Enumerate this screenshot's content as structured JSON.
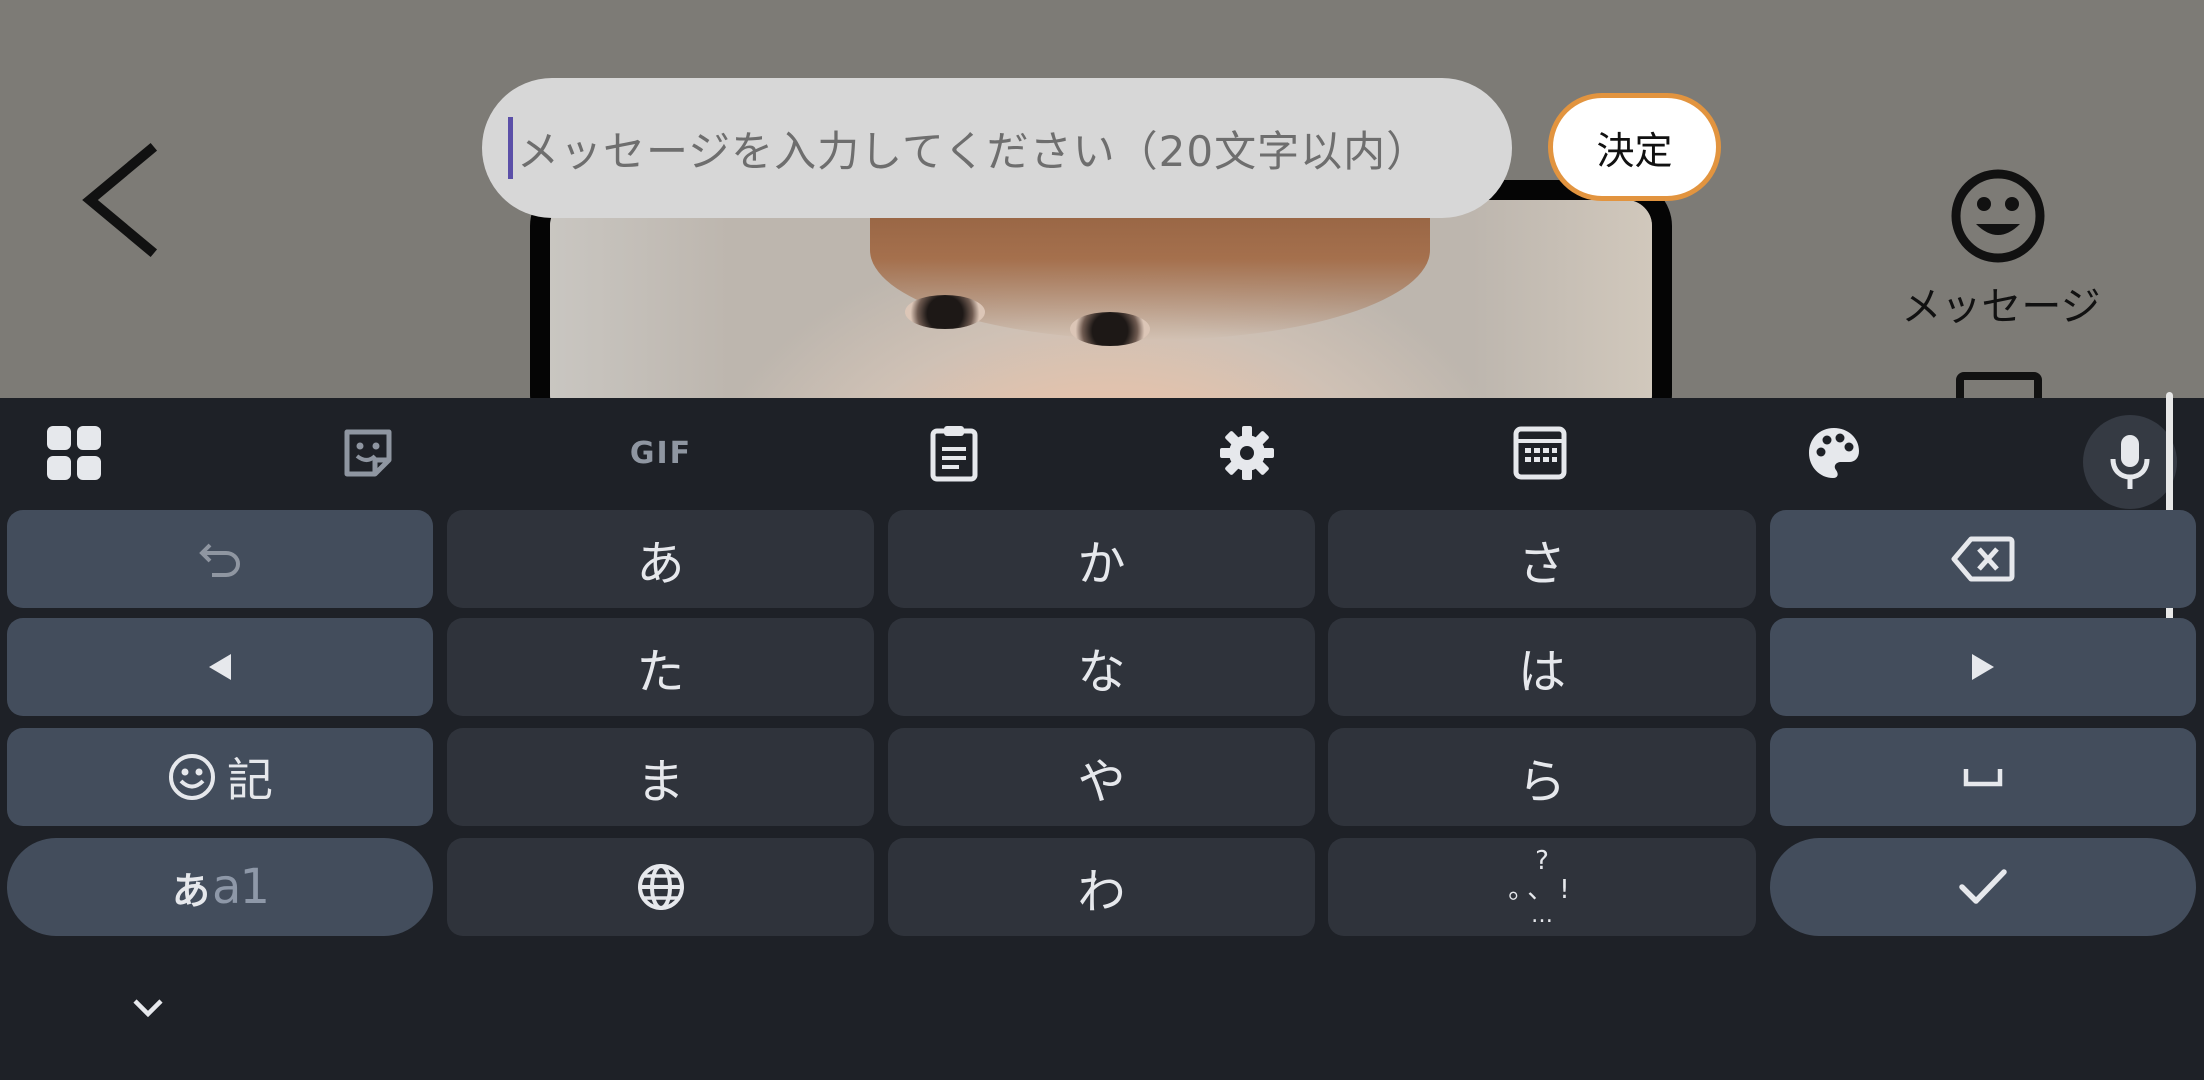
{
  "input": {
    "placeholder": "メッセージを入力してください（20文字以内）",
    "value": ""
  },
  "confirm_label": "決定",
  "side_panel": {
    "message_label": "メッセージ",
    "message_icon": "smile-icon"
  },
  "icons": {
    "back": "chevron-left-icon",
    "collapse": "chevron-down-icon"
  },
  "keyboard": {
    "toolbar": [
      {
        "name": "apps-grid-icon"
      },
      {
        "name": "sticker-icon"
      },
      {
        "name": "gif-icon",
        "label": "GIF"
      },
      {
        "name": "clipboard-icon"
      },
      {
        "name": "settings-gear-icon"
      },
      {
        "name": "keyboard-layout-icon"
      },
      {
        "name": "palette-icon"
      },
      {
        "name": "mic-icon"
      }
    ],
    "keys": {
      "undo_icon": "undo-icon",
      "a": "あ",
      "ka": "か",
      "sa": "さ",
      "backspace_icon": "backspace-icon",
      "left_icon": "cursor-left-icon",
      "ta": "た",
      "na": "な",
      "ha": "は",
      "right_icon": "cursor-right-icon",
      "emoji_symbol_label": "記",
      "ma": "ま",
      "ya": "や",
      "ra": "ら",
      "space_icon": "space-icon",
      "mode_kana": "あ",
      "mode_alnum": "a1",
      "globe_icon": "globe-icon",
      "wa": "わ",
      "punct_top": "?",
      "punct_mid": "。、!",
      "punct_bot": "…",
      "enter_icon": "check-icon"
    }
  },
  "colors": {
    "keyboard_bg": "#1e2127",
    "key_bg": "#2f333b",
    "fn_key_bg": "#434d5c",
    "confirm_border": "#e2943f",
    "caret": "#5b4fa8"
  }
}
